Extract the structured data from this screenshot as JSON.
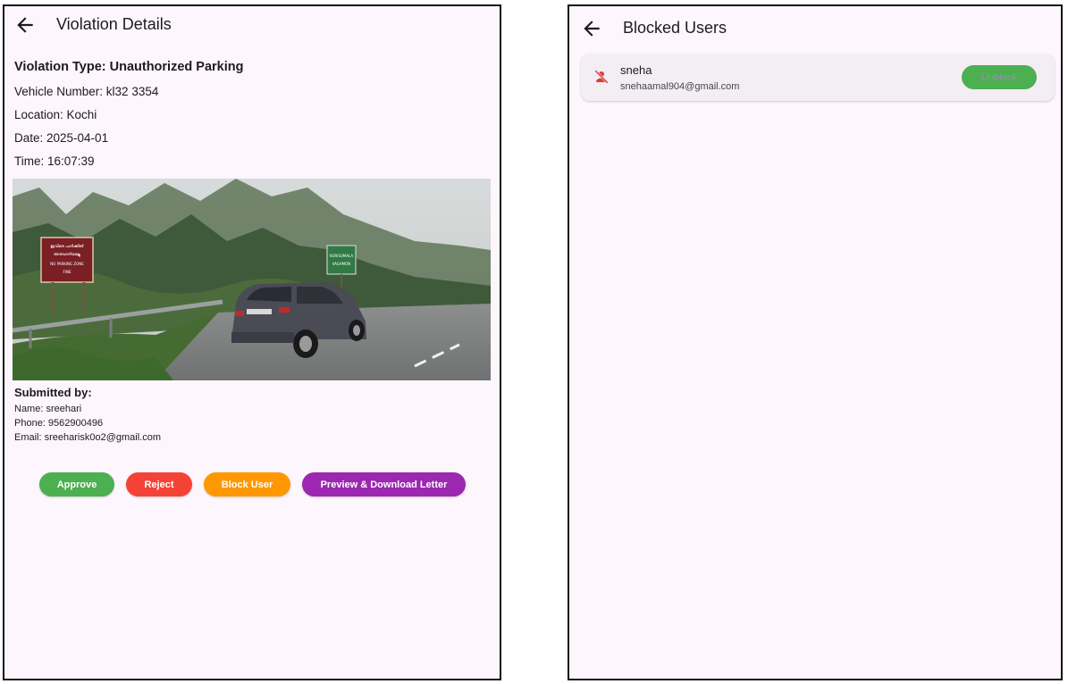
{
  "violation": {
    "title": "Violation Details",
    "type_line": "Violation Type: Unauthorized Parking",
    "vehicle_line": "Vehicle Number: kl32 3354",
    "location_line": "Location: Kochi",
    "date_line": "Date: 2025-04-01",
    "time_line": "Time: 16:07:39",
    "photo_signs": {
      "left_sign": [
        "ഇവിടെ പാർക്കിങ്",
        "അനുവദനീയമല്ല",
        "NO PARKING ZONE",
        "FINE"
      ],
      "right_sign": [
        "KURISUMALA",
        "VAGAMON"
      ]
    },
    "submitted_heading": "Submitted by:",
    "submitter_name": "Name: sreehari",
    "submitter_phone": "Phone: 9562900496",
    "submitter_email": "Email: sreeharisk0o2@gmail.com",
    "buttons": {
      "approve": "Approve",
      "reject": "Reject",
      "block": "Block User",
      "preview": "Preview & Download Letter"
    }
  },
  "blocked": {
    "title": "Blocked Users",
    "users": [
      {
        "name": "sneha",
        "email": "snehaamal904@gmail.com",
        "action": "Unblock"
      }
    ]
  },
  "colors": {
    "approve": "#4caf50",
    "reject": "#f44336",
    "block": "#ff9800",
    "preview": "#9c27b0",
    "blocked_icon": "#e53935"
  },
  "icons": {
    "back": "arrow-left-icon",
    "blocked_user": "person-off-icon"
  }
}
